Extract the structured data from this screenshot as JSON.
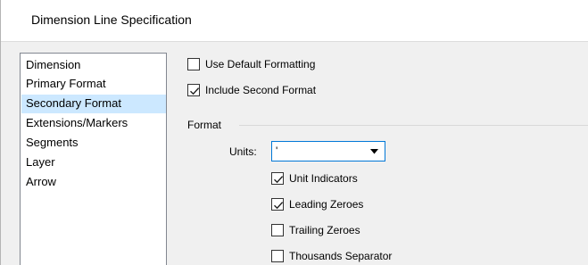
{
  "dialog": {
    "title": "Dimension Line Specification"
  },
  "sidebar": {
    "items": [
      {
        "label": "Dimension",
        "selected": false
      },
      {
        "label": "Primary Format",
        "selected": false
      },
      {
        "label": "Secondary Format",
        "selected": true
      },
      {
        "label": "Extensions/Markers",
        "selected": false
      },
      {
        "label": "Segments",
        "selected": false
      },
      {
        "label": "Layer",
        "selected": false
      },
      {
        "label": "Arrow",
        "selected": false
      }
    ]
  },
  "options": {
    "use_default_formatting": {
      "label": "Use Default Formatting",
      "checked": false
    },
    "include_second_format": {
      "label": "Include Second Format",
      "checked": true
    }
  },
  "format": {
    "group_label": "Format",
    "units": {
      "label": "Units:",
      "value": "'",
      "icon": "chevron-down-icon"
    },
    "unit_indicators": {
      "label": "Unit Indicators",
      "checked": true
    },
    "leading_zeroes": {
      "label": "Leading Zeroes",
      "checked": true
    },
    "trailing_zeroes": {
      "label": "Trailing Zeroes",
      "checked": false
    },
    "thousands_separator": {
      "label": "Thousands Separator",
      "checked": false
    }
  },
  "colors": {
    "selection": "#cce8ff",
    "focus_border": "#0078d7",
    "header_bg": "#ffffff",
    "body_bg": "#f0f0f0"
  }
}
